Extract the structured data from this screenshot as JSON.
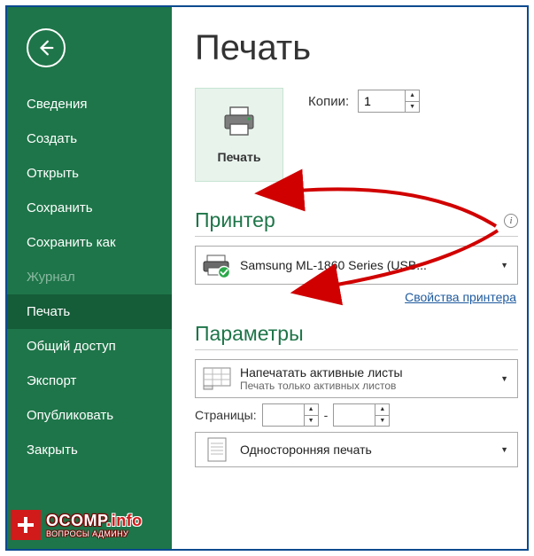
{
  "sidebar": {
    "items": [
      {
        "label": "Сведения"
      },
      {
        "label": "Создать"
      },
      {
        "label": "Открыть"
      },
      {
        "label": "Сохранить"
      },
      {
        "label": "Сохранить как"
      },
      {
        "label": "Журнал",
        "disabled": true
      },
      {
        "label": "Печать",
        "selected": true
      },
      {
        "label": "Общий доступ"
      },
      {
        "label": "Экспорт"
      },
      {
        "label": "Опубликовать"
      },
      {
        "label": "Закрыть"
      }
    ]
  },
  "page": {
    "title": "Печать"
  },
  "print_button": {
    "label": "Печать"
  },
  "copies": {
    "label": "Копии:",
    "value": "1"
  },
  "printer": {
    "section": "Принтер",
    "name": "Samsung ML-1860 Series (USB...",
    "properties_link": "Свойства принтера"
  },
  "settings": {
    "section": "Параметры",
    "active_sheets": {
      "primary": "Напечатать активные листы",
      "secondary": "Печать только активных листов"
    },
    "pages": {
      "label": "Страницы:",
      "from": "",
      "sep": "-",
      "to": ""
    },
    "sided": {
      "primary": "Односторонняя печать"
    }
  },
  "watermark": {
    "brand": "OCOMP",
    "suffix": ".info",
    "sub": "ВОПРОСЫ АДМИНУ"
  }
}
